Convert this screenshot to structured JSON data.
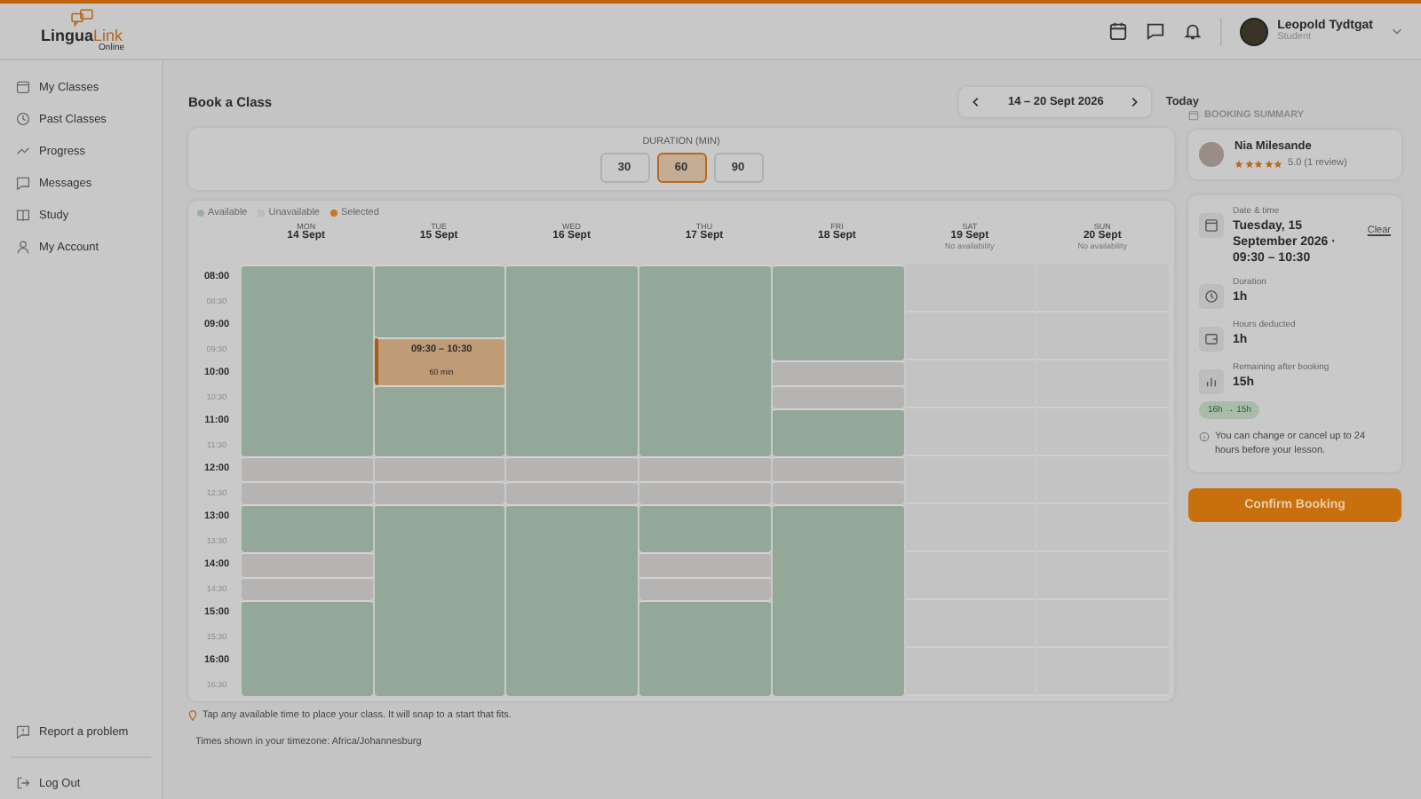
{
  "logo": {
    "word_1": "Lingua",
    "word_2": "Link",
    "tagline": "Online"
  },
  "user": {
    "name": "Leopold Tydtgat",
    "role": "Student"
  },
  "sidebar": {
    "items": [
      {
        "label": "My Classes",
        "kind": "calendar",
        "selected": false
      },
      {
        "label": "Past Classes",
        "kind": "clock",
        "selected": false
      },
      {
        "label": "Progress",
        "kind": "trend",
        "selected": false
      },
      {
        "label": "Messages",
        "kind": "chat",
        "selected": false
      },
      {
        "label": "Study",
        "kind": "book",
        "selected": false
      },
      {
        "label": "My Account",
        "kind": "person",
        "selected": false
      }
    ],
    "footer_items": [
      {
        "label": "Report a problem",
        "kind": "report"
      },
      {
        "label": "Log Out",
        "kind": "logout"
      }
    ]
  },
  "page": {
    "title": "Book a Class",
    "week": "14 – 20 Sept 2026",
    "today": "Today"
  },
  "duration": {
    "label": "DURATION (MIN)",
    "options": [
      {
        "label": "30",
        "selected": false
      },
      {
        "label": "60",
        "selected": true
      },
      {
        "label": "90",
        "selected": false
      }
    ]
  },
  "legend": [
    {
      "label": "Available",
      "kind": "available"
    },
    {
      "label": "Unavailable",
      "kind": "unavailable"
    },
    {
      "label": "Selected",
      "kind": "selected"
    }
  ],
  "calendar": {
    "times": [
      "08:00",
      "08:30",
      "09:00",
      "09:30",
      "10:00",
      "10:30",
      "11:00",
      "11:30",
      "12:00",
      "12:30",
      "13:00",
      "13:30",
      "14:00",
      "14:30",
      "15:00",
      "15:30",
      "16:00",
      "16:30"
    ],
    "days": [
      {
        "weekday": "MON",
        "date": "14 Sept",
        "slots": [
          {
            "kind": "available",
            "joined": false
          },
          {
            "kind": "available",
            "joined": true
          },
          {
            "kind": "available",
            "joined": true
          },
          {
            "kind": "available",
            "joined": true
          },
          {
            "kind": "available",
            "joined": true
          },
          {
            "kind": "available",
            "joined": true
          },
          {
            "kind": "available",
            "joined": true
          },
          {
            "kind": "available",
            "joined": true
          },
          {
            "kind": "unavailable",
            "joined": false
          },
          {
            "kind": "unavailable",
            "joined": false
          },
          {
            "kind": "available",
            "joined": false
          },
          {
            "kind": "available",
            "joined": true
          },
          {
            "kind": "unavailable",
            "joined": false
          },
          {
            "kind": "unavailable",
            "joined": false
          },
          {
            "kind": "available",
            "joined": false
          },
          {
            "kind": "available",
            "joined": true
          },
          {
            "kind": "available",
            "joined": true
          },
          {
            "kind": "available",
            "joined": true
          }
        ]
      },
      {
        "weekday": "TUE",
        "date": "15 Sept",
        "slots": [
          {
            "kind": "available",
            "joined": false
          },
          {
            "kind": "available",
            "joined": true
          },
          {
            "kind": "available",
            "joined": true
          },
          {
            "kind": "selected",
            "joined": false,
            "label": "09:30 – 10:30"
          },
          {
            "kind": "selected",
            "joined": true,
            "label": "60 min"
          },
          {
            "kind": "available",
            "joined": false
          },
          {
            "kind": "available",
            "joined": true
          },
          {
            "kind": "available",
            "joined": true
          },
          {
            "kind": "unavailable",
            "joined": false
          },
          {
            "kind": "unavailable",
            "joined": false
          },
          {
            "kind": "available",
            "joined": false
          },
          {
            "kind": "available",
            "joined": true
          },
          {
            "kind": "available",
            "joined": true
          },
          {
            "kind": "available",
            "joined": true
          },
          {
            "kind": "available",
            "joined": true
          },
          {
            "kind": "available",
            "joined": true
          },
          {
            "kind": "available",
            "joined": true
          },
          {
            "kind": "available",
            "joined": true
          }
        ]
      },
      {
        "weekday": "WED",
        "date": "16 Sept",
        "slots": [
          {
            "kind": "available",
            "joined": false
          },
          {
            "kind": "available",
            "joined": true
          },
          {
            "kind": "available",
            "joined": true
          },
          {
            "kind": "available",
            "joined": true
          },
          {
            "kind": "available",
            "joined": true
          },
          {
            "kind": "available",
            "joined": true
          },
          {
            "kind": "available",
            "joined": true
          },
          {
            "kind": "available",
            "joined": true
          },
          {
            "kind": "unavailable",
            "joined": false
          },
          {
            "kind": "unavailable",
            "joined": false
          },
          {
            "kind": "available",
            "joined": false
          },
          {
            "kind": "available",
            "joined": true
          },
          {
            "kind": "available",
            "joined": true
          },
          {
            "kind": "available",
            "joined": true
          },
          {
            "kind": "available",
            "joined": true
          },
          {
            "kind": "available",
            "joined": true
          },
          {
            "kind": "available",
            "joined": true
          },
          {
            "kind": "available",
            "joined": true
          }
        ]
      },
      {
        "weekday": "THU",
        "date": "17 Sept",
        "slots": [
          {
            "kind": "available",
            "joined": false
          },
          {
            "kind": "available",
            "joined": true
          },
          {
            "kind": "available",
            "joined": true
          },
          {
            "kind": "available",
            "joined": true
          },
          {
            "kind": "available",
            "joined": true
          },
          {
            "kind": "available",
            "joined": true
          },
          {
            "kind": "available",
            "joined": true
          },
          {
            "kind": "available",
            "joined": true
          },
          {
            "kind": "unavailable",
            "joined": false
          },
          {
            "kind": "unavailable",
            "joined": false
          },
          {
            "kind": "available",
            "joined": false
          },
          {
            "kind": "available",
            "joined": true
          },
          {
            "kind": "unavailable",
            "joined": false
          },
          {
            "kind": "unavailable",
            "joined": false
          },
          {
            "kind": "available",
            "joined": false
          },
          {
            "kind": "available",
            "joined": true
          },
          {
            "kind": "available",
            "joined": true
          },
          {
            "kind": "available",
            "joined": true
          }
        ]
      },
      {
        "weekday": "FRI",
        "date": "18 Sept",
        "slots": [
          {
            "kind": "available",
            "joined": false
          },
          {
            "kind": "available",
            "joined": true
          },
          {
            "kind": "available",
            "joined": true
          },
          {
            "kind": "available",
            "joined": true
          },
          {
            "kind": "unavailable",
            "joined": false
          },
          {
            "kind": "unavailable",
            "joined": false
          },
          {
            "kind": "available",
            "joined": false
          },
          {
            "kind": "available",
            "joined": true
          },
          {
            "kind": "unavailable",
            "joined": false
          },
          {
            "kind": "unavailable",
            "joined": false
          },
          {
            "kind": "available",
            "joined": false
          },
          {
            "kind": "available",
            "joined": true
          },
          {
            "kind": "available",
            "joined": true
          },
          {
            "kind": "available",
            "joined": true
          },
          {
            "kind": "available",
            "joined": true
          },
          {
            "kind": "available",
            "joined": true
          },
          {
            "kind": "available",
            "joined": true
          },
          {
            "kind": "available",
            "joined": true
          }
        ]
      },
      {
        "weekday": "SAT",
        "date": "19 Sept",
        "note": "No availability"
      },
      {
        "weekday": "SUN",
        "date": "20 Sept",
        "note": "No availability"
      }
    ]
  },
  "hint": "Tap any available time to place your class. It will snap to a start that fits.",
  "timezone": "Times shown in your timezone: Africa/Johannesburg",
  "summary": {
    "heading": "BOOKING SUMMARY",
    "tutor": {
      "name": "Nia Milesande",
      "stars": 5,
      "rating": "5.0 (1 review)"
    },
    "details": [
      {
        "kind": "date",
        "label": "Date & time",
        "value": "Tuesday, 15 September 2026 · 09:30 – 10:30",
        "action": "Clear"
      },
      {
        "kind": "duration",
        "label": "Duration",
        "value": "1h"
      },
      {
        "kind": "hours",
        "label": "Hours deducted",
        "value": "1h"
      },
      {
        "kind": "remaining",
        "label": "Remaining after booking",
        "value": "15h"
      }
    ],
    "change": "16h → 15h",
    "policy": "You can change or cancel up to 24 hours before your lesson.",
    "confirm": "Confirm Booking"
  }
}
